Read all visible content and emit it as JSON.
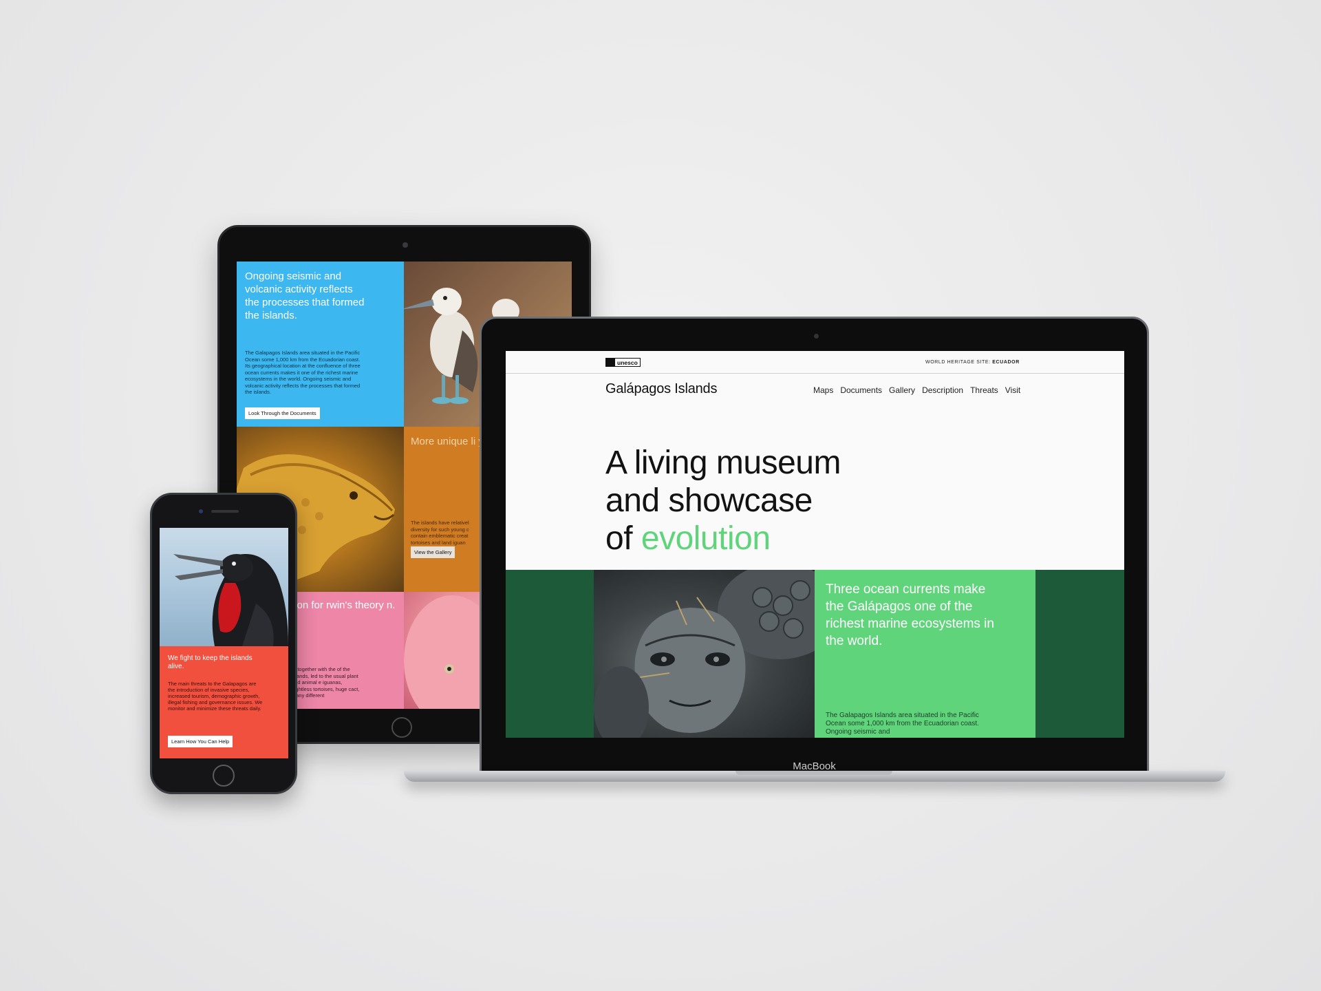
{
  "tablet": {
    "blue_card": {
      "heading": "Ongoing seismic and volcanic activity reflects the processes that formed the islands.",
      "body": "The Galapagos Islands area situated in the Pacific Ocean some 1,000 km from the Ecuadorian coast. Its geographical location at the confluence of three ocean currents makes it one of the richest marine ecosystems in the world. Ongoing seismic and volcanic activity reflects the processes that formed the islands.",
      "button": "Look Through the Documents"
    },
    "orange_card": {
      "heading": "More unique li you can imag",
      "body": "The islands have relativel diversity for such young c contain emblematic creat tortoises and land iguan",
      "button": "View the Gallery"
    },
    "pink_card": {
      "heading": "tion for rwin's theory n.",
      "body": "n, together with the of the islands, led to the usual plant and animal e iguanas, flightless tortoises, huge cact, many different"
    }
  },
  "laptop": {
    "brand_label": "MacBook",
    "site": {
      "logo_text": "unesco",
      "heritage_prefix": "WORLD HERITAGE SITE:",
      "heritage_country": "ECUADOR",
      "title": "Galápagos Islands",
      "nav": [
        "Maps",
        "Documents",
        "Gallery",
        "Description",
        "Threats",
        "Visit"
      ],
      "hero_line1": "A living museum",
      "hero_line2": "and showcase",
      "hero_line3_prefix": "of ",
      "hero_line3_accent": "evolution",
      "card_heading": "Three ocean currents make the Galápagos one of the richest marine ecosystems in the world.",
      "card_body": "The Galapagos Islands area situated in the Pacific Ocean some 1,000 km from the Ecuadorian coast. Ongoing seismic and"
    }
  },
  "phone": {
    "heading": "We fight to keep the islands alive.",
    "body": "The main threats to the Galapagos are the introduction of invasive species, increased tourism, demographic growth, illegal fishing and governance issues. We monitor and minimize these threats daily.",
    "button": "Learn How You Can Help"
  },
  "colors": {
    "accent_green": "#5fd47b",
    "dark_green": "#1d5a3a",
    "sky_blue": "#3db7ef",
    "coral": "#f2503f",
    "pink": "#ee86a8",
    "orange": "#cf7c22"
  }
}
